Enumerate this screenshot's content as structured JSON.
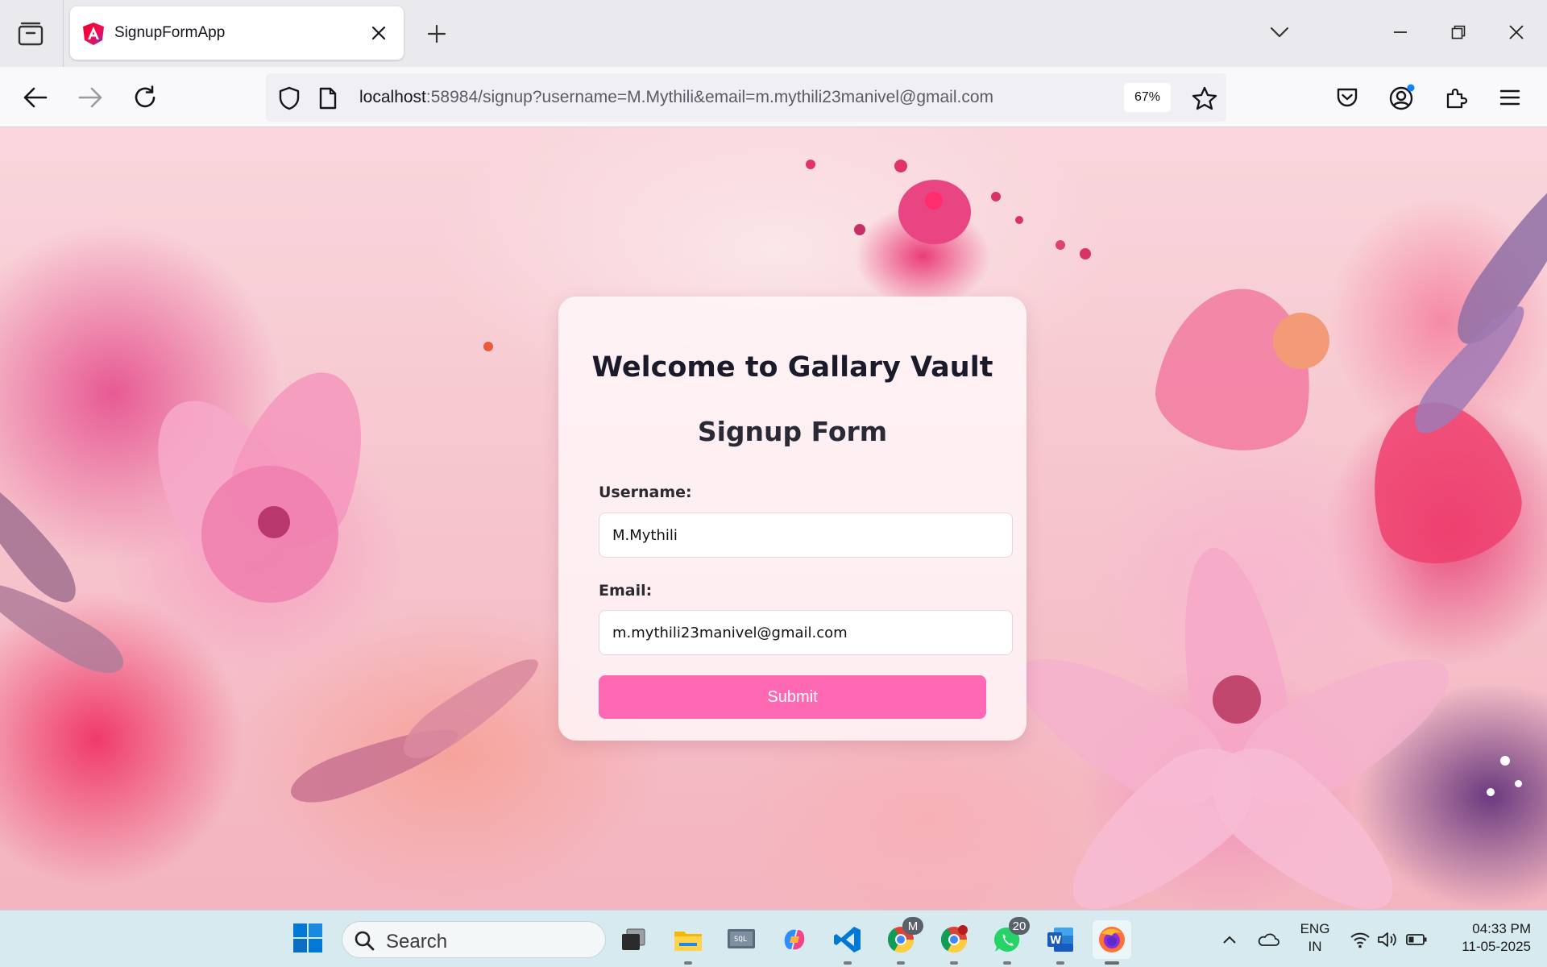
{
  "browser": {
    "tab_title": "SignupFormApp",
    "url_host": "localhost",
    "url_rest": ":58984/signup?username=M.Mythili&email=m.mythili23manivel@gmail.com",
    "zoom": "67%"
  },
  "form": {
    "heading": "Welcome to Gallary Vault",
    "subheading": "Signup Form",
    "username_label": "Username:",
    "username_value": "M.Mythili",
    "email_label": "Email:",
    "email_value": "m.mythili23manivel@gmail.com",
    "submit_label": "Submit"
  },
  "taskbar": {
    "search_placeholder": "Search",
    "apps": [
      "task-view",
      "file-explorer",
      "sql-developer",
      "copilot",
      "vscode",
      "chrome-profile-m",
      "chrome",
      "whatsapp",
      "word",
      "firefox"
    ],
    "whatsapp_badge": "20",
    "chrome_profile_badge": "M",
    "lang_line1": "ENG",
    "lang_line2": "IN",
    "time": "04:33 PM",
    "date": "11-05-2025"
  },
  "colors": {
    "accent_pink": "#ff69b4",
    "firefox_orange": "#ff7139",
    "vscode_blue": "#0078d4"
  }
}
